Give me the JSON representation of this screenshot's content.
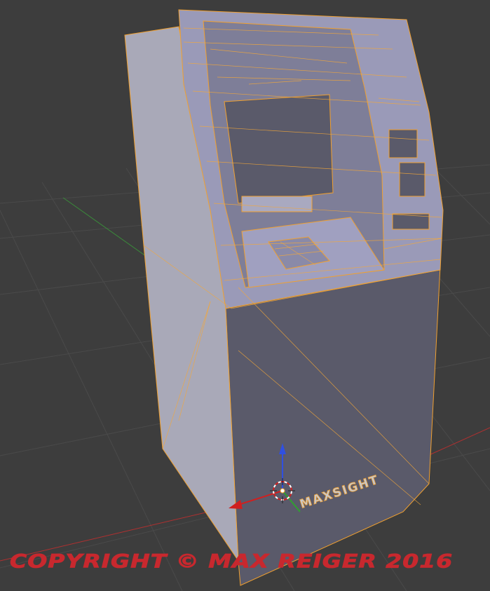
{
  "viewport": {
    "background": "#3d3d3d",
    "grid_color": "#4a4a4a",
    "axis_x_color": "#b03030",
    "axis_y_color": "#3a8a3a",
    "wireframe_color": "#f0a030",
    "object_fill": "#5a5a6a",
    "highlight_fill": "#9a9ab8"
  },
  "model": {
    "brand_label": "MAXSIGHT"
  },
  "gizmo": {
    "icons": [
      "3d-cursor-icon",
      "z-axis-arrow-icon",
      "x-axis-arrow-icon",
      "y-axis-arrow-icon"
    ]
  },
  "watermark": {
    "text": "COPYRIGHT © MAX REIGER 2016",
    "color": "#c8282e"
  }
}
